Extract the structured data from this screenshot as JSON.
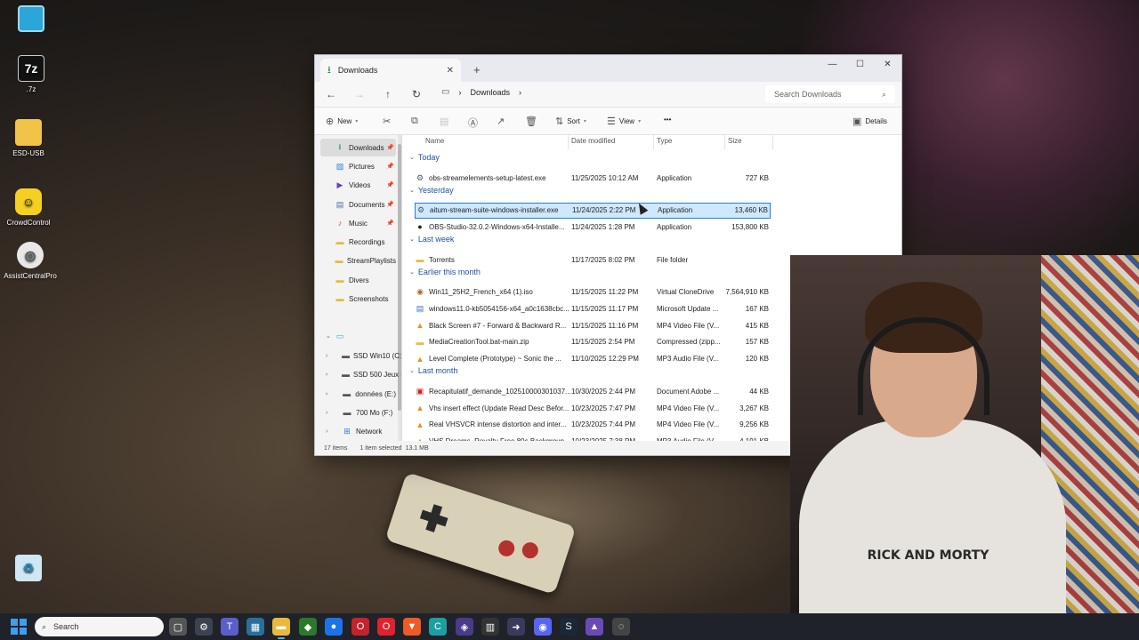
{
  "desktop_icons": [
    {
      "label": "",
      "name": "monitor"
    },
    {
      "label": ".7z",
      "name": "7zip"
    },
    {
      "label": "ESD-USB",
      "name": "folder"
    },
    {
      "label": "CrowdControl",
      "name": "crowdcontrol"
    },
    {
      "label": "AssistCentralPro",
      "name": "assistcentral"
    },
    {
      "label": "",
      "name": "recycle-bin"
    }
  ],
  "window": {
    "tab_title": "Downloads",
    "new_tab": "+",
    "breadcrumb": "Downloads",
    "search_placeholder": "Search Downloads",
    "toolbar": {
      "new_label": "New",
      "sort_label": "Sort",
      "view_label": "View",
      "more_label": "•••",
      "details_label": "Details"
    },
    "nav_pane": [
      {
        "label": "Downloads",
        "icon": "download-icon",
        "pinned": true,
        "active": true
      },
      {
        "label": "Pictures",
        "icon": "pictures-icon",
        "pinned": true
      },
      {
        "label": "Videos",
        "icon": "videos-icon",
        "pinned": true
      },
      {
        "label": "Documents",
        "icon": "documents-icon",
        "pinned": true
      },
      {
        "label": "Music",
        "icon": "music-icon",
        "pinned": true
      },
      {
        "label": "Recordings",
        "icon": "folder-icon"
      },
      {
        "label": "StreamPlaylists",
        "icon": "folder-icon"
      },
      {
        "label": "Divers",
        "icon": "folder-icon"
      },
      {
        "label": "Screenshots",
        "icon": "folder-icon"
      },
      {
        "label": "",
        "icon": "this-pc-icon"
      },
      {
        "label": "SSD Win10 (C:)",
        "icon": "drive-icon"
      },
      {
        "label": "SSD 500 Jeux (I",
        "icon": "drive-icon"
      },
      {
        "label": "données (E:)",
        "icon": "drive-icon"
      },
      {
        "label": "700 Mo (F:)",
        "icon": "drive-icon"
      },
      {
        "label": "Network",
        "icon": "network-icon"
      }
    ],
    "columns": {
      "name": "Name",
      "date": "Date modified",
      "type": "Type",
      "size": "Size"
    },
    "groups": [
      {
        "label": "Today",
        "files": [
          {
            "name": "obs-streamelements-setup-latest.exe",
            "date": "11/25/2025 10:12 AM",
            "type": "Application",
            "size": "727 KB",
            "icon": "exe"
          }
        ]
      },
      {
        "label": "Yesterday",
        "files": [
          {
            "name": "aitum-stream-suite-windows-installer.exe",
            "date": "11/24/2025 2:22 PM",
            "type": "Application",
            "size": "13,460 KB",
            "icon": "exe",
            "selected": true
          },
          {
            "name": "OBS-Studio-32.0.2-Windows-x64-Installe...",
            "date": "11/24/2025 1:28 PM",
            "type": "Application",
            "size": "153,800 KB",
            "icon": "obs"
          }
        ]
      },
      {
        "label": "Last week",
        "files": [
          {
            "name": "Torrents",
            "date": "11/17/2025 8:02 PM",
            "type": "File folder",
            "size": "",
            "icon": "folder"
          }
        ]
      },
      {
        "label": "Earlier this month",
        "files": [
          {
            "name": "Win11_25H2_French_x64 (1).iso",
            "date": "11/15/2025 11:22 PM",
            "type": "Virtual CloneDrive",
            "size": "7,564,910 KB",
            "icon": "iso"
          },
          {
            "name": "windows11.0-kb5054156-x64_a0c1638cbc...",
            "date": "11/15/2025 11:17 PM",
            "type": "Microsoft Update ...",
            "size": "167 KB",
            "icon": "update"
          },
          {
            "name": "Black Screen #7 - Forward & Backward R...",
            "date": "11/15/2025 11:16 PM",
            "type": "MP4 Video File (V...",
            "size": "415 KB",
            "icon": "vlc"
          },
          {
            "name": "MediaCreationTool.bat-main.zip",
            "date": "11/15/2025 2:54 PM",
            "type": "Compressed (zipp...",
            "size": "157 KB",
            "icon": "zip"
          },
          {
            "name": "Level Complete (Prototype) ~ Sonic the ...",
            "date": "11/10/2025 12:29 PM",
            "type": "MP3 Audio File (V...",
            "size": "120 KB",
            "icon": "vlc"
          }
        ]
      },
      {
        "label": "Last month",
        "files": [
          {
            "name": "Recapitulatif_demande_102510000301037...",
            "date": "10/30/2025 2:44 PM",
            "type": "Document Adobe ...",
            "size": "44 KB",
            "icon": "pdf"
          },
          {
            "name": "Vhs insert effect (Update Read Desc Befor...",
            "date": "10/23/2025 7:47 PM",
            "type": "MP4 Video File (V...",
            "size": "3,267 KB",
            "icon": "vlc"
          },
          {
            "name": "Real VHSVCR intense distortion and inter...",
            "date": "10/23/2025 7:44 PM",
            "type": "MP4 Video File (V...",
            "size": "9,256 KB",
            "icon": "vlc"
          },
          {
            "name": "VHS Dreams, Royalty Free 80s Backgroun...",
            "date": "10/23/2025 7:38 PM",
            "type": "MP3 Audio File (V...",
            "size": "4,191 KB",
            "icon": "vlc"
          }
        ]
      }
    ],
    "status": {
      "count": "17 items",
      "selected": "1 item selected",
      "size": "13.1 MB"
    }
  },
  "webcam": {
    "shirt_text": "RICK AND MORTY"
  },
  "taskbar": {
    "search_label": "Search"
  }
}
